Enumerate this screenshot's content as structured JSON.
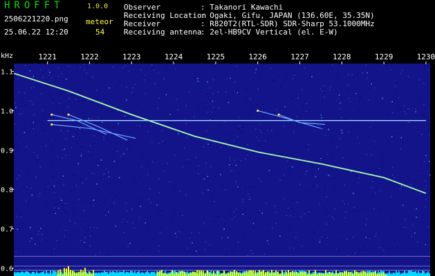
{
  "header": {
    "logo": "HROFFT",
    "version": "1.0.0",
    "filename": "2506221220.png",
    "datetime": "25.06.22 12:20",
    "meteor_label": "meteor",
    "meteor_count": "54",
    "info": [
      {
        "label": "Observer",
        "value": ": Takanori Kawachi"
      },
      {
        "label": "Receiving Location",
        "value": ": Ogaki, Gifu, JAPAN (136.60E, 35.35N)"
      },
      {
        "label": "Receiver",
        "value": ": R820T2(RTL-SDR) SDR-Sharp 53.1000MHz"
      },
      {
        "label": "Receiving antenna",
        "value": ": 2el-HB9CV Vertical (el. E-W)"
      }
    ]
  },
  "chart_data": {
    "type": "heatmap",
    "ylabel": "kHz",
    "x_ticks": [
      "1221",
      "1222",
      "1223",
      "1224",
      "1225",
      "1226",
      "1227",
      "1228",
      "1229",
      "1230"
    ],
    "x_tick_values": [
      1221,
      1222,
      1223,
      1224,
      1225,
      1226,
      1227,
      1228,
      1229,
      1230
    ],
    "xlim": [
      1220.2,
      1230.1
    ],
    "y_ticks": [
      "1.1",
      "1.0",
      "0.9",
      "0.8",
      "0.7",
      "0.6"
    ],
    "y_tick_values": [
      1.1,
      1.0,
      0.9,
      0.8,
      0.7,
      0.6
    ],
    "ylim": [
      0.58,
      1.12
    ],
    "colors": {
      "background": "#14148a",
      "carrier": "#9ad4ff",
      "meteor": "#ffe060",
      "drift": "#a8ffb0",
      "signal_bar": "#ffff00",
      "noise_bar": "#00d8ff"
    },
    "carrier_line": {
      "y": 0.975,
      "x_start": 1221.0,
      "x_end": 1230.0
    },
    "drift_line": [
      [
        1220.2,
        1.095
      ],
      [
        1221.5,
        1.05
      ],
      [
        1223.0,
        0.99
      ],
      [
        1224.5,
        0.935
      ],
      [
        1226.0,
        0.895
      ],
      [
        1227.5,
        0.865
      ],
      [
        1229.0,
        0.83
      ],
      [
        1230.0,
        0.79
      ]
    ],
    "meteor_echoes": [
      {
        "points": [
          [
            1221.1,
            0.99
          ],
          [
            1221.7,
            0.975
          ],
          [
            1222.4,
            0.94
          ]
        ]
      },
      {
        "points": [
          [
            1221.1,
            0.965
          ],
          [
            1222.0,
            0.955
          ],
          [
            1223.1,
            0.93
          ]
        ]
      },
      {
        "points": [
          [
            1221.5,
            0.99
          ],
          [
            1222.2,
            0.96
          ],
          [
            1222.9,
            0.925
          ]
        ]
      },
      {
        "points": [
          [
            1226.0,
            1.0
          ],
          [
            1226.7,
            0.98
          ],
          [
            1227.5,
            0.955
          ]
        ]
      },
      {
        "points": [
          [
            1226.5,
            0.99
          ],
          [
            1227.0,
            0.97
          ],
          [
            1227.6,
            0.965
          ]
        ]
      }
    ]
  }
}
